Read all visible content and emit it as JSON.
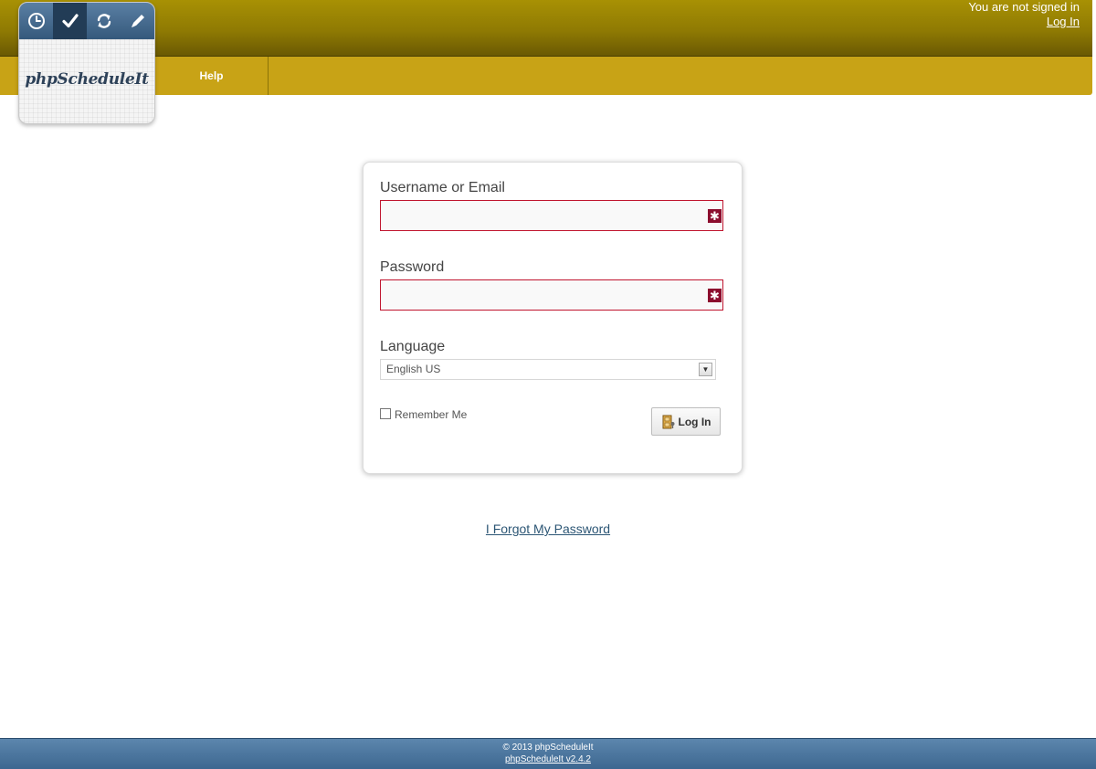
{
  "header": {
    "signin_status": "You are not signed in",
    "login_link": "Log In",
    "nav": {
      "help": "Help"
    },
    "colors": {
      "header": "#8f7a03",
      "nav": "#c8a316"
    }
  },
  "logo": {
    "text": "phpScheduleIt",
    "icons": [
      "clock-icon",
      "check-icon",
      "refresh-icon",
      "pencil-icon"
    ]
  },
  "login": {
    "username_label": "Username or Email",
    "username_value": "",
    "password_label": "Password",
    "password_value": "",
    "required_marker": "✱",
    "language_label": "Language",
    "language_selected": "English US",
    "remember_label": "Remember Me",
    "login_button": "Log In",
    "colors": {
      "required_border": "#c0152f",
      "required_icon": "#8c0d2e"
    }
  },
  "forgot_link": "I Forgot My Password",
  "footer": {
    "copyright": "© 2013 phpScheduleIt",
    "version": "phpScheduleIt v2.4.2",
    "color": "#4d77a0"
  }
}
